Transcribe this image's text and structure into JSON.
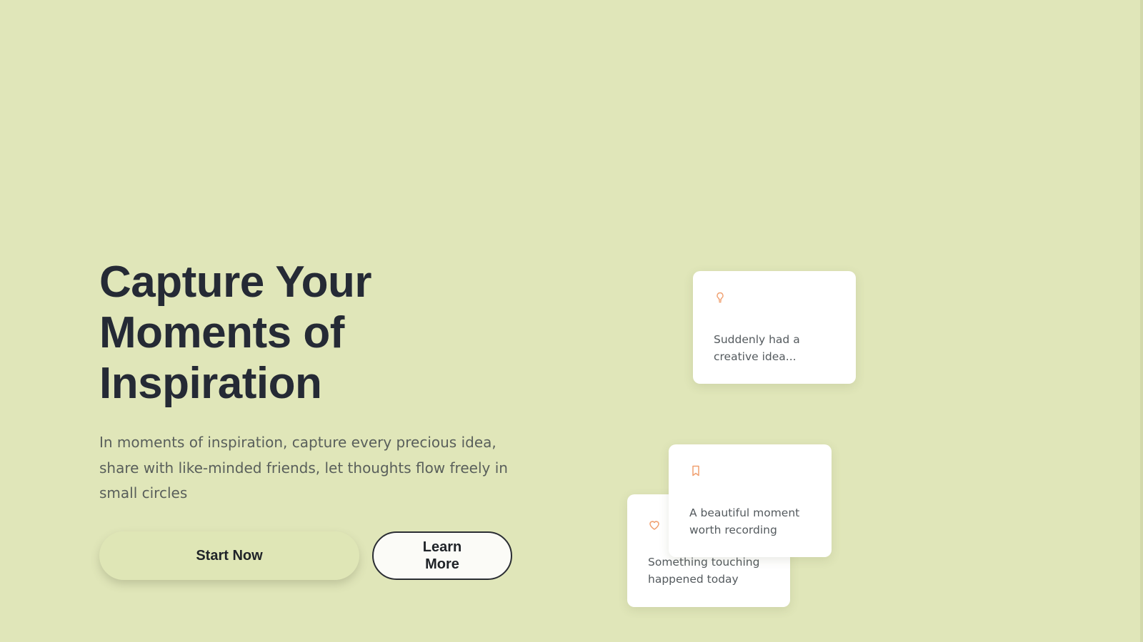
{
  "hero": {
    "title_lines": [
      "Capture Your",
      "Moments of",
      "Inspiration"
    ],
    "description": "In moments of inspiration, capture every precious idea, share with like-minded friends, let thoughts flow freely in small circles"
  },
  "actions": {
    "primary_label": "Start Now",
    "secondary_label": "Learn More"
  },
  "cards": [
    {
      "icon": "lightbulb-icon",
      "text": "Suddenly had a creative idea..."
    },
    {
      "icon": "bookmark-icon",
      "text": "A beautiful moment worth recording"
    },
    {
      "icon": "heart-icon",
      "text": "Something touching happened today"
    }
  ],
  "colors": {
    "background": "#e0e6b9",
    "heading": "#252a35",
    "accent_icon": "#f0a070",
    "card": "#ffffff"
  }
}
